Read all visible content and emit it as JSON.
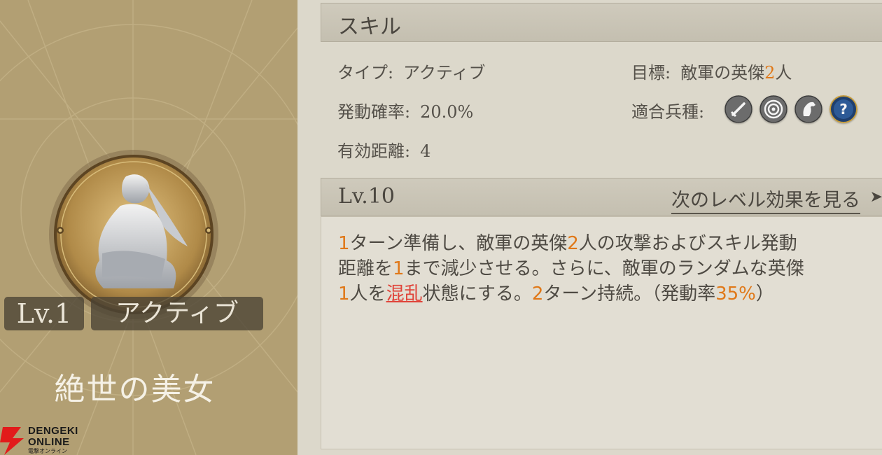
{
  "card": {
    "level": "Lv.1",
    "type": "アクティブ",
    "name": "絶世の美女",
    "logo": {
      "line1": "DENGEKI",
      "line2": "ONLINE",
      "line3": "電撃オンライン"
    }
  },
  "skill": {
    "header": "スキル",
    "type_label": "タイプ:",
    "type_value": "アクティブ",
    "rate_label": "発動確率:",
    "rate_value": "20.0%",
    "range_label": "有効距離:",
    "range_value": "4",
    "target_label": "目標:",
    "target_pre": "敵軍の英傑",
    "target_num": "2",
    "target_post": "人",
    "unit_label": "適合兵種:",
    "unit_icons": [
      "sword-icon",
      "target-icon",
      "horse-icon",
      "question-icon"
    ]
  },
  "level": {
    "label": "Lv.10",
    "next_link": "次のレベル効果を見る",
    "arrow": "➤"
  },
  "description": {
    "l1a": "1",
    "l1b": "ターン準備し、敵軍の英傑",
    "l1c": "2",
    "l1d": "人の攻撃およびスキル発動",
    "l2a": "距離を",
    "l2b": "1",
    "l2c": "まで減少させる。さらに、敵軍のランダムな英傑",
    "l3a": "1",
    "l3b": "人を",
    "l3c": "混乱",
    "l3d": "状態にする。",
    "l3e": "2",
    "l3f": "ターン持続。（発動率",
    "l3g": "35%",
    "l3h": "）"
  },
  "colors": {
    "accent": "#e07818",
    "keyword": "#e0443a",
    "card": "#b29f73"
  }
}
